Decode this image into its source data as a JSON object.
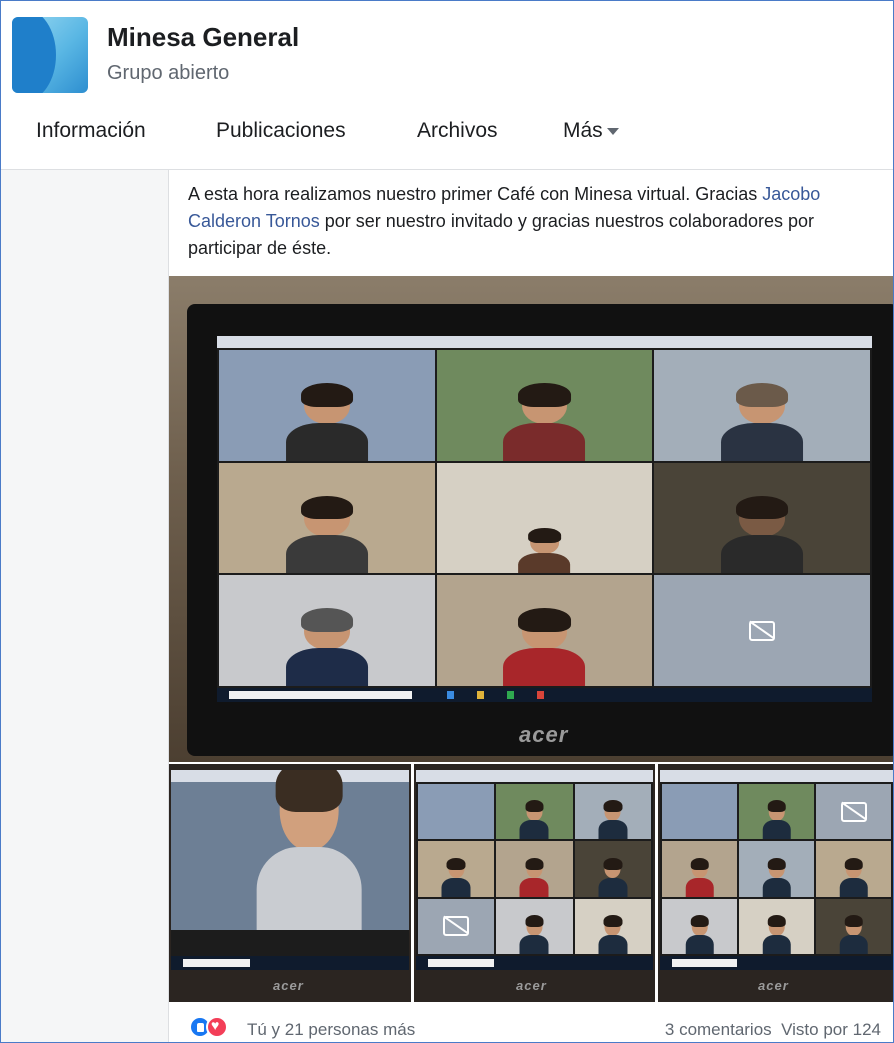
{
  "group": {
    "name": "Minesa General",
    "type": "Grupo abierto",
    "logo_icon": "minesa-logo"
  },
  "tabs": [
    {
      "label": "Información"
    },
    {
      "label": "Publicaciones"
    },
    {
      "label": "Archivos"
    },
    {
      "label": "Más"
    }
  ],
  "post": {
    "text_before": "A esta hora realizamos nuestro primer Café con Minesa virtual. Gracias ",
    "mention": "Jacobo Calderon Tornos",
    "text_after": " por ser nuestro invitado y gracias nuestros colaboradores por participar de éste.",
    "photos": {
      "main_brand": "acer",
      "thumb_brands": [
        "acer",
        "acer",
        "acer"
      ]
    },
    "reactions": {
      "icons": [
        "like-icon",
        "love-icon"
      ],
      "summary": "Tú y 21 personas más"
    },
    "comments": "3 comentarios",
    "seen_by": "Visto por 124"
  },
  "colors": {
    "link": "#385898",
    "like": "#1877f2",
    "love": "#f33e58",
    "frame_border": "#4a7bc8"
  }
}
